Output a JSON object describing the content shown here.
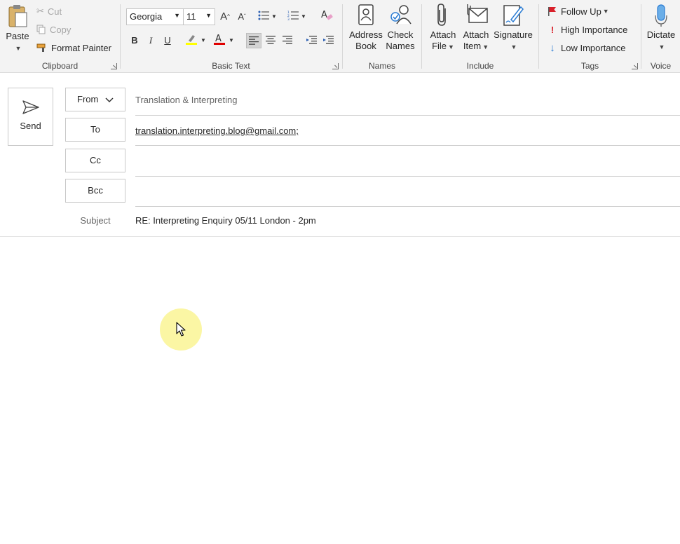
{
  "ribbon": {
    "clipboard": {
      "label": "Clipboard",
      "paste": "Paste",
      "cut": "Cut",
      "copy": "Copy",
      "format_painter": "Format Painter"
    },
    "basic_text": {
      "label": "Basic Text",
      "font_name": "Georgia",
      "font_size": "11"
    },
    "names": {
      "label": "Names",
      "address_book_1": "Address",
      "address_book_2": "Book",
      "check_names_1": "Check",
      "check_names_2": "Names"
    },
    "include": {
      "label": "Include",
      "attach_file_1": "Attach",
      "attach_file_2": "File",
      "attach_item_1": "Attach",
      "attach_item_2": "Item",
      "signature": "Signature"
    },
    "tags": {
      "label": "Tags",
      "follow_up": "Follow Up",
      "high_importance": "High Importance",
      "low_importance": "Low Importance"
    },
    "voice": {
      "label": "Voice",
      "dictate": "Dictate"
    }
  },
  "compose": {
    "send": "Send",
    "from_label": "From",
    "from_value": "Translation & Interpreting",
    "to_label": "To",
    "to_value": "translation.interpreting.blog@gmail.com;",
    "cc_label": "Cc",
    "cc_value": "",
    "bcc_label": "Bcc",
    "bcc_value": "",
    "subject_label": "Subject",
    "subject_value": "RE: Interpreting Enquiry 05/11 London - 2pm"
  },
  "colors": {
    "highlight": "#ffff00",
    "font_color": "#e00000",
    "follow_up_flag": "#d9202a",
    "high_importance": "#d9202a",
    "low_importance": "#2b7cd3",
    "icon_blue": "#2b7cd3",
    "cursor_halo": "#fbf59a"
  }
}
